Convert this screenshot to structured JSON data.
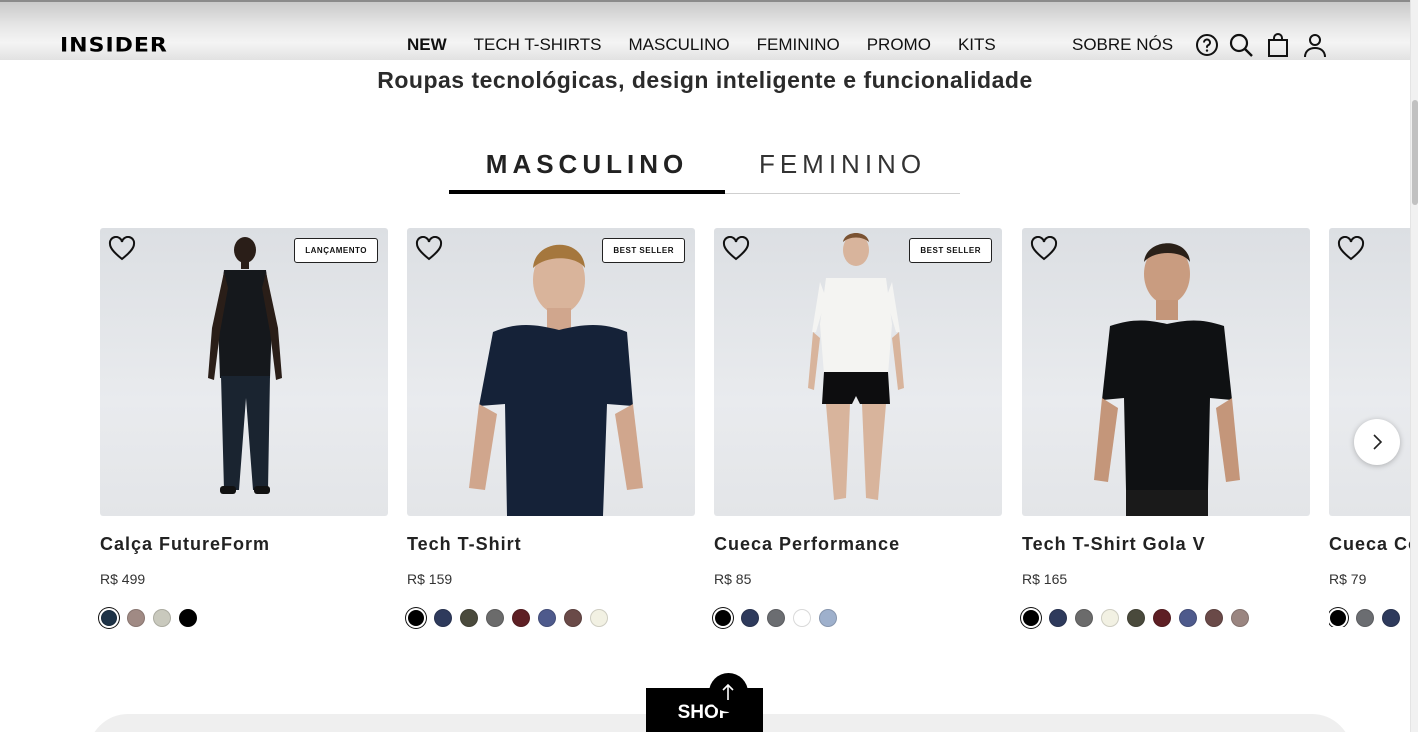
{
  "header": {
    "logo": "INSIDER",
    "nav": [
      "NEW",
      "TECH T-SHIRTS",
      "MASCULINO",
      "FEMININO",
      "PROMO",
      "KITS"
    ],
    "about": "SOBRE NÓS",
    "icons": [
      "help-icon",
      "search-icon",
      "bag-icon",
      "user-icon"
    ]
  },
  "tagline": "Roupas tecnológicas, design inteligente e funcionalidade",
  "tabs": {
    "masculino": "MASCULINO",
    "feminino": "FEMININO",
    "active": "MASCULINO"
  },
  "products": [
    {
      "name": "Calça FutureForm",
      "price": "R$ 499",
      "badge": "LANÇAMENTO",
      "swatches": [
        "#1e3347",
        "#a08a84",
        "#c9c9bd",
        "#000000"
      ]
    },
    {
      "name": "Tech T-Shirt",
      "price": "R$ 159",
      "badge": "BEST SELLER",
      "swatches": [
        "#000000",
        "#2e3a5c",
        "#4a4a3c",
        "#6b6b6b",
        "#5e1f24",
        "#4e5a8c",
        "#6a4a48",
        "#f2f1e3"
      ]
    },
    {
      "name": "Cueca Performance",
      "price": "R$ 85",
      "badge": "BEST SELLER",
      "swatches": [
        "#000000",
        "#2e3a5c",
        "#6b6d71",
        "#ffffff",
        "#9eb0cc"
      ]
    },
    {
      "name": "Tech T-Shirt Gola V",
      "price": "R$ 165",
      "badge": "",
      "swatches": [
        "#000000",
        "#2e3a5c",
        "#6b6b6b",
        "#f2f1e3",
        "#4a4a3c",
        "#5e1f24",
        "#4e5a8c",
        "#6a4a48",
        "#9a8580"
      ]
    },
    {
      "name": "Cueca Co",
      "price": "R$ 79",
      "badge": "",
      "swatches": [
        "#000000",
        "#6b6d71",
        "#2e3a5c"
      ]
    }
  ],
  "shop_button": "SHOP",
  "colors": {
    "accent": "#000000",
    "background": "#ffffff"
  }
}
